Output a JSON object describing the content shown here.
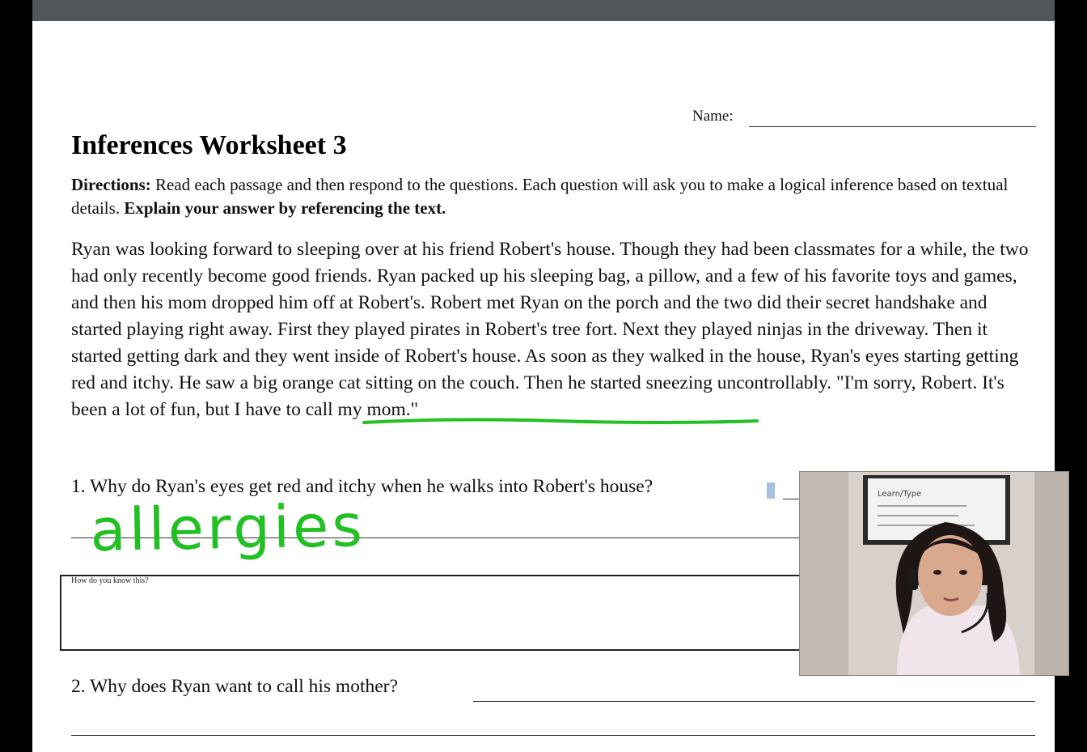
{
  "worksheet": {
    "name_label": "Name:",
    "title": "Inferences Worksheet 3",
    "directions_label": "Directions:",
    "directions_text": " Read each passage and then respond to the questions. Each question will ask you to make a logical inference based on textual details. ",
    "directions_emphasis": "Explain your answer by referencing the text.",
    "passage_before": "Ryan was looking forward to sleeping over at his friend Robert's house. Though they had been classmates for a while, the two had only recently become good friends. Ryan packed up his sleeping bag, a pillow, and a few of his favorite toys and games, and then his mom dropped him off at Robert's. Robert met Ryan on the porch and the two did their secret handshake and started playing right away. First they played pirates in Robert's tree fort. Next they played ninjas in the driveway. Then it started getting dark and they went inside of Robert's house. As soon as they walked in the house, Ryan's eyes starting getting red and itchy. He ",
    "passage_underlined": "saw a big orange cat sitting on the couch.",
    "passage_after": " Then he started sneezing uncontrollably. \"I'm sorry, Robert. It's been a lot of fun, but I have to call my mom.\"",
    "question_1": "1. Why do Ryan's eyes get red and itchy when he walks into Robert's house?",
    "evidence_prompt": "How do you know this?",
    "question_2": "2. Why does Ryan want to call his mother?"
  },
  "annotations": {
    "handwritten_answer": "allergies",
    "ink_color": "#22c022"
  },
  "webcam": {
    "whiteboard_text": "Learn/Type"
  }
}
